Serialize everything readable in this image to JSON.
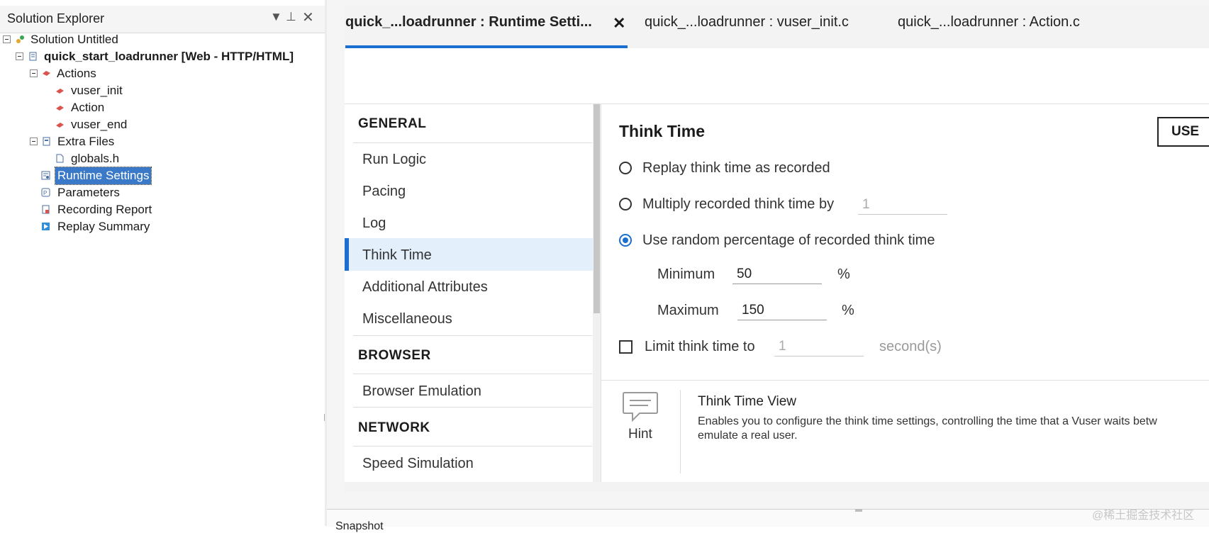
{
  "solution_explorer": {
    "title": "Solution Explorer",
    "tree": [
      {
        "label": "Solution Untitled",
        "icon": "solution-icon"
      },
      {
        "label": "quick_start_loadrunner [Web - HTTP/HTML]",
        "icon": "script-icon"
      },
      {
        "label": "Actions",
        "icon": "actions-icon"
      },
      {
        "label": "vuser_init",
        "icon": "action-file-icon"
      },
      {
        "label": "Action",
        "icon": "action-file-icon"
      },
      {
        "label": "vuser_end",
        "icon": "action-file-icon"
      },
      {
        "label": "Extra Files",
        "icon": "extra-files-icon"
      },
      {
        "label": "globals.h",
        "icon": "file-icon"
      },
      {
        "label": "Runtime Settings",
        "icon": "runtime-settings-icon"
      },
      {
        "label": "Parameters",
        "icon": "parameters-icon"
      },
      {
        "label": "Recording Report",
        "icon": "report-icon"
      },
      {
        "label": "Replay Summary",
        "icon": "replay-icon"
      }
    ]
  },
  "tabs": [
    {
      "label": "quick_...loadrunner : Runtime Setti...",
      "active": true
    },
    {
      "label": "quick_...loadrunner : vuser_init.c",
      "active": false
    },
    {
      "label": "quick_...loadrunner : Action.c",
      "active": false
    }
  ],
  "nav": {
    "general": "GENERAL",
    "general_items": [
      "Run Logic",
      "Pacing",
      "Log",
      "Think Time",
      "Additional Attributes",
      "Miscellaneous"
    ],
    "browser": "BROWSER",
    "browser_items": [
      "Browser Emulation"
    ],
    "network": "NETWORK",
    "network_items": [
      "Speed Simulation"
    ],
    "active": "Think Time"
  },
  "content": {
    "title": "Think Time",
    "use_button": "USE",
    "opt_replay": "Replay think time as recorded",
    "opt_multiply": "Multiply recorded think time by",
    "multiply_value": "1",
    "opt_random": "Use random percentage of recorded think time",
    "min_label": "Minimum",
    "min_value": "50",
    "max_label": "Maximum",
    "max_value": "150",
    "percent": "%",
    "limit_label": "Limit think time to",
    "limit_value": "1",
    "limit_unit": "second(s)"
  },
  "hint": {
    "label": "Hint",
    "title": "Think Time View",
    "desc_line1": "Enables you to configure the think time settings, controlling the time that a Vuser waits betw",
    "desc_line2": "emulate a real user."
  },
  "snapshot": {
    "label": "Snapshot"
  },
  "watermark": "@稀土掘金技术社区",
  "colors": {
    "accent": "#1a6fd1",
    "active_bg": "#e3f0fb",
    "selection": "#3a78c8"
  }
}
